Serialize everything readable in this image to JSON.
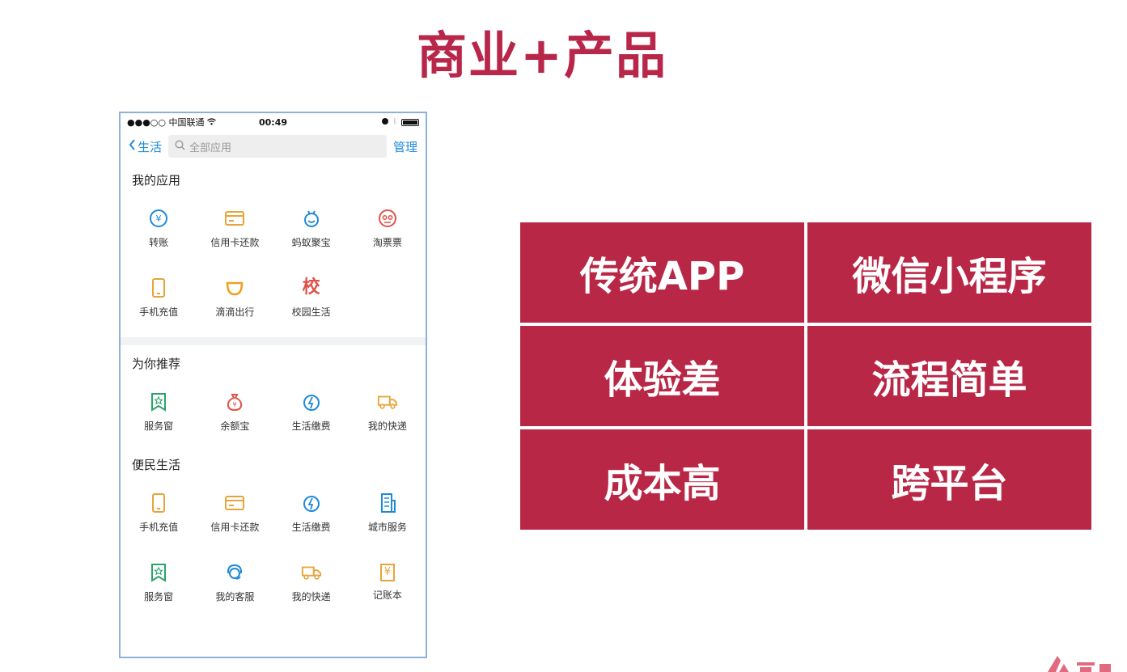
{
  "slide": {
    "title": "商业+产品"
  },
  "phone": {
    "status": {
      "carrier": "●●●○○ 中国联通",
      "time": "00:49"
    },
    "nav": {
      "back_label": "生活",
      "search_placeholder": "全部应用",
      "manage_label": "管理"
    },
    "sections": [
      {
        "title": "我的应用",
        "apps": [
          {
            "label": "转账",
            "icon": "transfer-icon"
          },
          {
            "label": "信用卡还款",
            "icon": "credit-card-icon"
          },
          {
            "label": "蚂蚁聚宝",
            "icon": "ant-fortune-icon"
          },
          {
            "label": "淘票票",
            "icon": "tao-ticket-icon"
          },
          {
            "label": "手机充值",
            "icon": "phone-recharge-icon"
          },
          {
            "label": "滴滴出行",
            "icon": "didi-icon"
          },
          {
            "label": "校园生活",
            "icon": "campus-icon",
            "glyph": "校"
          }
        ]
      },
      {
        "title": "为你推荐",
        "apps": [
          {
            "label": "服务窗",
            "icon": "service-window-icon"
          },
          {
            "label": "余额宝",
            "icon": "yuebao-icon"
          },
          {
            "label": "生活缴费",
            "icon": "utility-payment-icon"
          },
          {
            "label": "我的快递",
            "icon": "delivery-truck-icon"
          }
        ]
      },
      {
        "title": "便民生活",
        "apps": [
          {
            "label": "手机充值",
            "icon": "phone-recharge-icon"
          },
          {
            "label": "信用卡还款",
            "icon": "credit-card-icon"
          },
          {
            "label": "生活缴费",
            "icon": "utility-payment-icon"
          },
          {
            "label": "城市服务",
            "icon": "city-service-icon"
          },
          {
            "label": "服务窗",
            "icon": "service-window-icon"
          },
          {
            "label": "我的客服",
            "icon": "customer-service-icon"
          },
          {
            "label": "我的快递",
            "icon": "delivery-truck-icon"
          },
          {
            "label": "记账本",
            "icon": "ledger-icon",
            "glyph": "¥"
          }
        ]
      }
    ]
  },
  "matrix": {
    "cells": [
      "传统APP",
      "微信小程序",
      "体验差",
      "流程简单",
      "成本高",
      "跨平台"
    ]
  },
  "colors": {
    "accent": "#b92747",
    "link": "#1f8ad8"
  }
}
